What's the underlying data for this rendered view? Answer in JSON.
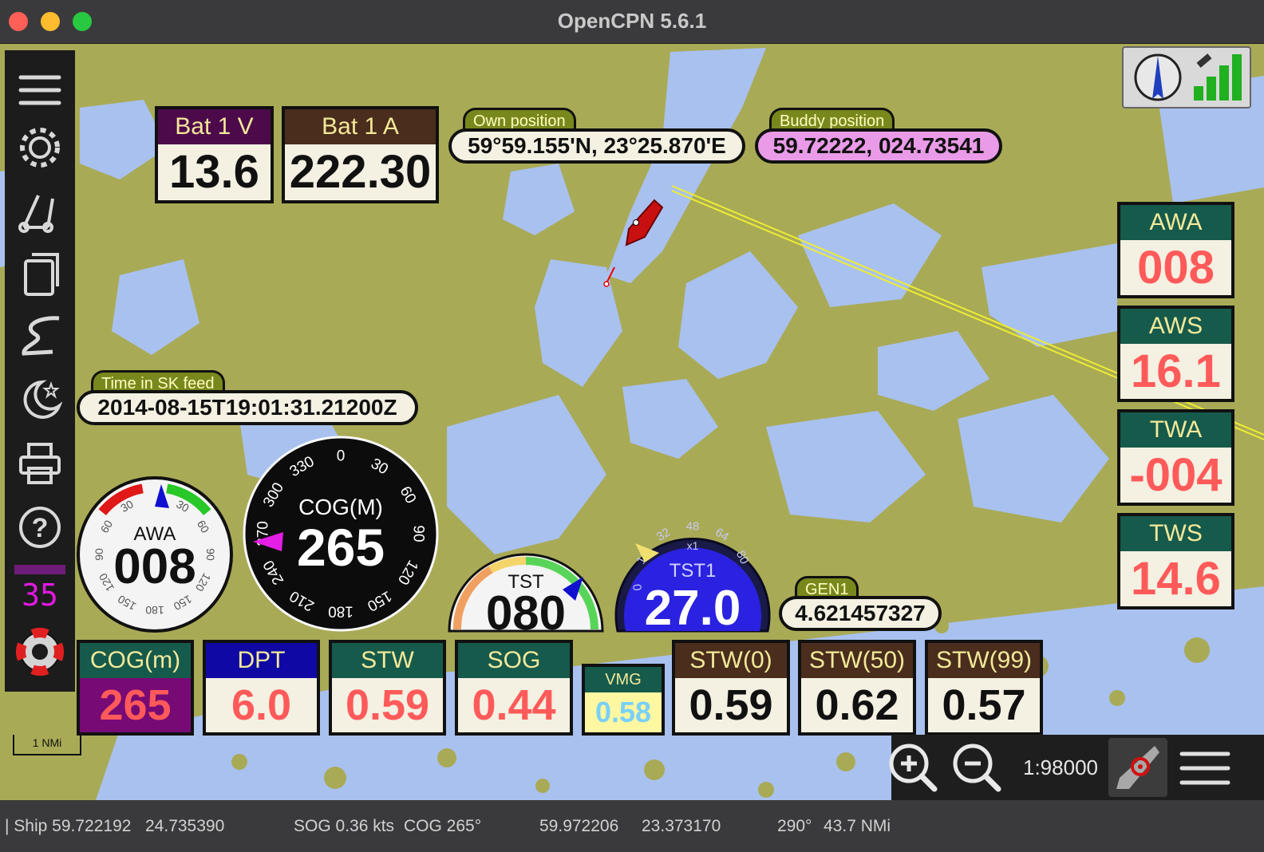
{
  "window": {
    "title": "OpenCPN 5.6.1"
  },
  "colors": {
    "land": "#a9aa56",
    "water": "#a9c1ef",
    "header_green": "#165a4b",
    "header_brown": "#4a2d1c",
    "header_purple": "#4d0a4b",
    "header_blue": "#1008a4",
    "value_red": "#ff5a5a"
  },
  "toolbar": {
    "items": [
      "menu-icon",
      "settings-icon",
      "route-icon",
      "layers-icon",
      "track-icon",
      "night-mode-icon",
      "print-icon",
      "help-icon",
      "counter",
      "lifebuoy-icon"
    ],
    "counter_value": "35"
  },
  "top_right": {
    "compass_icon": "compass-icon",
    "gps_icon": "gps-signal-icon"
  },
  "bat1v": {
    "label": "Bat 1 V",
    "value": "13.6"
  },
  "bat1a": {
    "label": "Bat 1 A",
    "value": "222.30"
  },
  "own_position": {
    "label": "Own position",
    "value": "59°59.155'N, 23°25.870'E"
  },
  "buddy_position": {
    "label": "Buddy position",
    "value": "59.72222, 024.73541"
  },
  "sk_time": {
    "label": "Time in SK feed",
    "value": "2014-08-15T19:01:31.21200Z"
  },
  "right_panel": [
    {
      "label": "AWA",
      "value": "008"
    },
    {
      "label": "AWS",
      "value": "16.1"
    },
    {
      "label": "TWA",
      "value": "-004"
    },
    {
      "label": "TWS",
      "value": "14.6"
    }
  ],
  "awa_gauge": {
    "label": "AWA",
    "value": "008",
    "ticks": [
      "30",
      "60",
      "90",
      "120",
      "150",
      "180",
      "150",
      "120",
      "90",
      "60",
      "30"
    ]
  },
  "cog_gauge": {
    "label": "COG(M)",
    "value": "265",
    "ticks": [
      "0",
      "30",
      "60",
      "90",
      "120",
      "150",
      "180",
      "210",
      "240",
      "270",
      "300",
      "330"
    ]
  },
  "tst_gauge": {
    "label": "TST",
    "value": "080"
  },
  "tst1_gauge": {
    "label": "TST1",
    "value": "27.0",
    "ticks": [
      "16",
      "32",
      "48",
      "64",
      "80",
      "0"
    ],
    "multiplier": "x1"
  },
  "gen1": {
    "label": "GEN1",
    "value": "4.621457327"
  },
  "bottom_row": [
    {
      "label": "COG(m)",
      "value": "265"
    },
    {
      "label": "DPT",
      "value": "6.0"
    },
    {
      "label": "STW",
      "value": "0.59"
    },
    {
      "label": "SOG",
      "value": "0.44"
    },
    {
      "label": "VMG",
      "value": "0.58"
    },
    {
      "label": "STW(0)",
      "value": "0.59"
    },
    {
      "label": "STW(50)",
      "value": "0.62"
    },
    {
      "label": "STW(99)",
      "value": "0.57"
    }
  ],
  "scale_bar": {
    "label": "1 NMi"
  },
  "zoom": {
    "zoom_in": "zoom-in-icon",
    "zoom_out": "zoom-out-icon",
    "scale": "1:98000",
    "ownship": "ownship-icon",
    "menu": "menu-icon"
  },
  "status": {
    "ship_label": "| Ship 59.722192",
    "ship_lon": "24.735390",
    "sog": "SOG 0.36 kts",
    "cog": "COG 265°",
    "cursor_lat": "59.972206",
    "cursor_lon": "23.373170",
    "bearing": "290°",
    "distance": "43.7 NMi"
  }
}
